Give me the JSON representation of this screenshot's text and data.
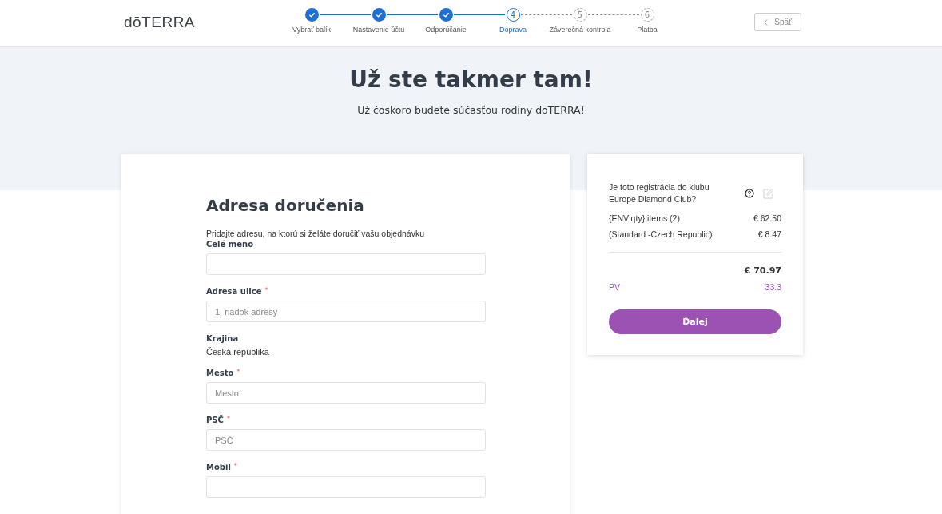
{
  "header": {
    "logo": "dōTERRA",
    "back_button": "Späť"
  },
  "steps": [
    {
      "label": "Vybrať balík",
      "completed": true,
      "selected": false
    },
    {
      "label": "Nastavenie účtu",
      "completed": true,
      "selected": false
    },
    {
      "label": "Odporúčanie",
      "completed": true,
      "selected": false
    },
    {
      "number": "4",
      "label": "Doprava",
      "completed": false,
      "selected": true
    },
    {
      "number": "5",
      "label": "Záverečná kontrola",
      "completed": false,
      "selected": false
    },
    {
      "number": "6",
      "label": "Platba",
      "completed": false,
      "selected": false
    }
  ],
  "hero": {
    "title": "Už ste takmer tam!",
    "subtitle": "Už čoskoro budete súčasťou rodiny dōTERRA!"
  },
  "form": {
    "title": "Adresa doručenia",
    "intro": "Pridajte adresu, na ktorú si želáte doručiť vašu objednávku",
    "fields": [
      {
        "kind": "input",
        "label": "Celé meno"
      },
      {
        "kind": "input",
        "label": "Adresa ulice",
        "asterisk": "*",
        "placeholder": "1. riadok adresy"
      },
      {
        "kind": "static",
        "label": "Krajina",
        "value": "Česká republika"
      },
      {
        "kind": "input",
        "label": "Mesto",
        "asterisk": "*",
        "placeholder": "Mesto"
      },
      {
        "kind": "input",
        "label": "PSČ",
        "asterisk": "*",
        "placeholder": "PSČ"
      },
      {
        "kind": "input",
        "label": "Mobil",
        "asterisk": "*"
      }
    ]
  },
  "summary": {
    "question": "Je toto registrácia do klubu Europe Diamond Club?",
    "lines": [
      {
        "label": "{ENV:qty} items (2)",
        "amount": "€ 62.50"
      },
      {
        "label": "(Standard -Czech Republic)",
        "amount": "€ 8.47"
      }
    ],
    "total": "€ 70.97",
    "pv_label": "PV",
    "pv_value": "33.3",
    "button": "Ďalej"
  }
}
